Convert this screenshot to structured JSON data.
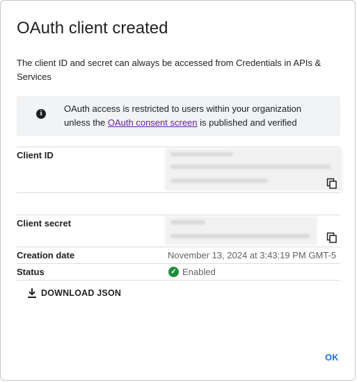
{
  "dialog": {
    "title": "OAuth client created",
    "description": "The client ID and secret can always be accessed from Credentials in APIs & Services",
    "info": {
      "text_before": "OAuth access is restricted to users within your organization unless the ",
      "link": "OAuth consent screen",
      "text_after": " is published and verified"
    },
    "fields": {
      "client_id_label": "Client ID",
      "client_secret_label": "Client secret",
      "creation_date_label": "Creation date",
      "creation_date_value": "November 13, 2024 at 3:43:19 PM GMT-5",
      "status_label": "Status",
      "status_value": "Enabled"
    },
    "download_label": "DOWNLOAD JSON",
    "ok_label": "OK"
  },
  "icons": {
    "info": "info-icon",
    "copy": "copy-icon",
    "status": "check-circle-icon",
    "download": "download-icon"
  },
  "colors": {
    "link": "#681da8",
    "status_ok": "#1e8e3e",
    "primary": "#1a73e8"
  }
}
